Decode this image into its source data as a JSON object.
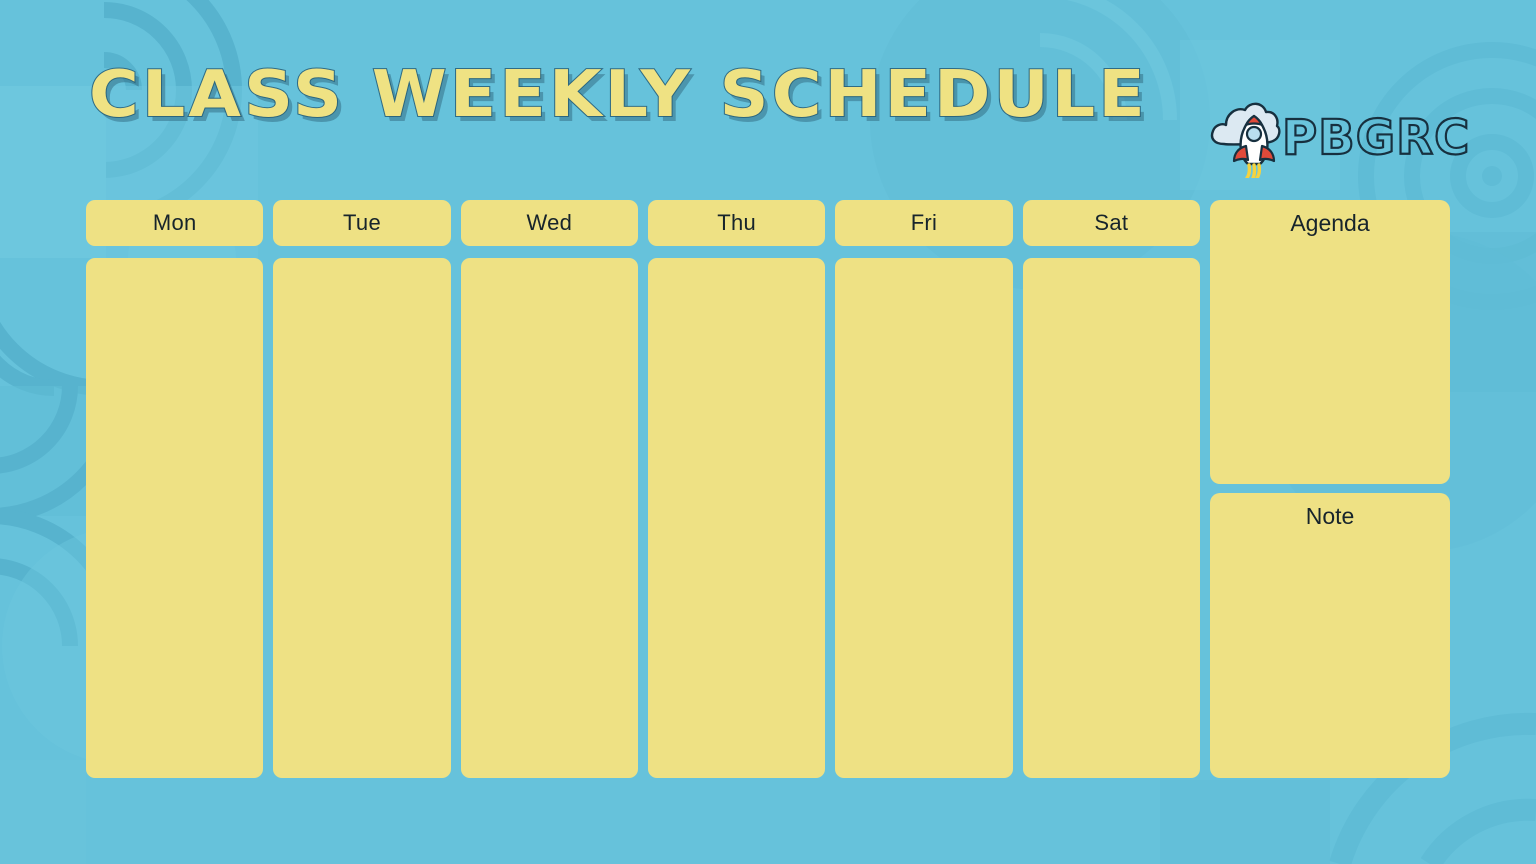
{
  "page": {
    "title": "CLASS WEEKLY SCHEDULE",
    "background_color": "#66c2db",
    "card_color": "#eee184",
    "text_color": "#17242b",
    "title_outline_color": "#2f6c86"
  },
  "logo": {
    "brand": "PBGRC",
    "mark_icon": "rocket-cloud-icon",
    "rocket_body_color": "#ffffff",
    "rocket_accent_color": "#e04a3a",
    "rocket_window_color": "#b9dff0",
    "rocket_flame_color": "#f5d33f",
    "cloud_color": "#dce9f2",
    "outline_color": "#17303f"
  },
  "schedule": {
    "days": [
      {
        "label": "Mon",
        "entries": ""
      },
      {
        "label": "Tue",
        "entries": ""
      },
      {
        "label": "Wed",
        "entries": ""
      },
      {
        "label": "Thu",
        "entries": ""
      },
      {
        "label": "Fri",
        "entries": ""
      },
      {
        "label": "Sat",
        "entries": ""
      }
    ]
  },
  "sidebar": {
    "panels": [
      {
        "label": "Agenda",
        "content": ""
      },
      {
        "label": "Note",
        "content": ""
      }
    ]
  }
}
